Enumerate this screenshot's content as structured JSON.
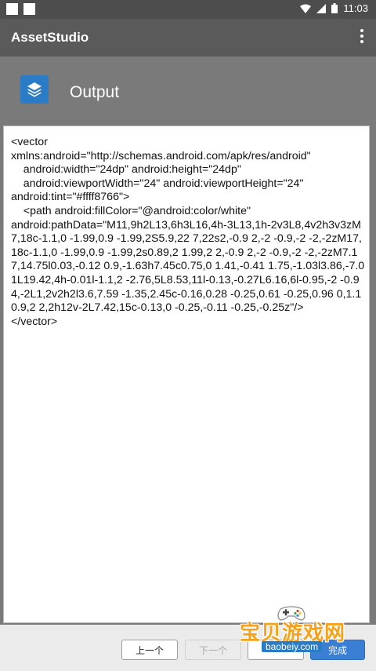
{
  "status_bar": {
    "time": "11:03"
  },
  "app_bar": {
    "title": "AssetStudio"
  },
  "header": {
    "title": "Output"
  },
  "output_text": "<vector\nxmlns:android=\"http://schemas.android.com/apk/res/android\"\n    android:width=\"24dp\" android:height=\"24dp\"\n    android:viewportWidth=\"24\" android:viewportHeight=\"24\"\nandroid:tint=\"#ffff8766\">\n    <path android:fillColor=\"@android:color/white\"\nandroid:pathData=\"M11,9h2L13,6h3L16,4h-3L13,1h-2v3L8,4v2h3v3zM7,18c-1.1,0 -1.99,0.9 -1.99,2S5.9,22 7,22s2,-0.9 2,-2 -0.9,-2 -2,-2zM17,18c-1.1,0 -1.99,0.9 -1.99,2s0.89,2 1.99,2 2,-0.9 2,-2 -0.9,-2 -2,-2zM7.17,14.75l0.03,-0.12 0.9,-1.63h7.45c0.75,0 1.41,-0.41 1.75,-1.03l3.86,-7.01L19.42,4h-0.01l-1.1,2 -2.76,5L8.53,11l-0.13,-0.27L6.16,6l-0.95,-2 -0.94,-2L1,2v2h2l3.6,7.59 -1.35,2.45c-0.16,0.28 -0.25,0.61 -0.25,0.96 0,1.1 0.9,2 2,2h12v-2L7.42,15c-0.13,0 -0.25,-0.11 -0.25,-0.25z\"/>\n</vector>",
  "bottom_bar": {
    "prev_label": "上一个",
    "next_label": "下一个",
    "third_label": "",
    "done_label": "完成"
  },
  "watermark": {
    "brand_cn": "宝贝游戏网",
    "url": "baobeiy.com"
  },
  "colors": {
    "app_bar": "#5a5a5a",
    "header": "#7a7a7a",
    "accent": "#2a7cc7",
    "done_button": "#3a7fd4"
  }
}
